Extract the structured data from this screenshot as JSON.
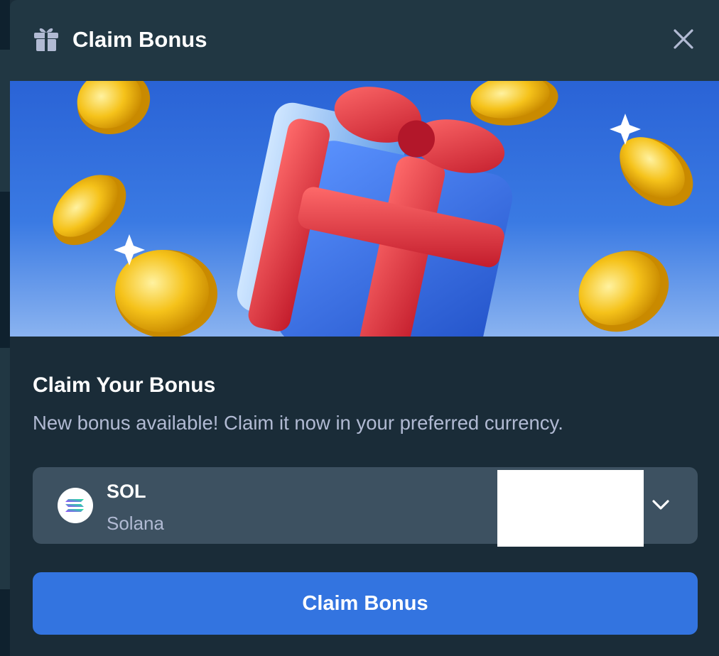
{
  "modal": {
    "title": "Claim Bonus",
    "header_icon": "gift-icon",
    "close_icon": "close-icon"
  },
  "banner": {
    "image_description": "gift-box-with-coins",
    "colors": {
      "sky_top": "#2a63d6",
      "sky_bottom": "#8ab3f0",
      "box": "#3d78e6",
      "ribbon": "#e0323d",
      "coin": "#f2b512"
    }
  },
  "content": {
    "heading": "Claim Your Bonus",
    "description": "New bonus available! Claim it now in your preferred currency."
  },
  "currency_select": {
    "code": "SOL",
    "name": "Solana",
    "icon": "solana-icon",
    "dropdown_icon": "chevron-down-icon"
  },
  "claim_button": {
    "label": "Claim Bonus"
  },
  "colors": {
    "modal_bg": "#1a2c38",
    "header_bg": "#213743",
    "select_bg": "#3d5161",
    "button_bg": "#3374e0",
    "muted_text": "#b1bad3",
    "text": "#ffffff"
  }
}
